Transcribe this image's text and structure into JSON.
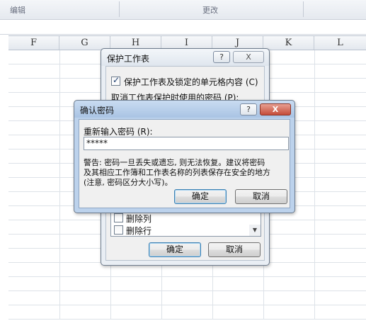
{
  "ribbon": {
    "group1": "编辑",
    "group2": "更改"
  },
  "columns": [
    "F",
    "G",
    "H",
    "I",
    "J",
    "K",
    "L"
  ],
  "protect_dialog": {
    "title": "保护工作表",
    "help_glyph": "?",
    "close_glyph": "X",
    "protect_checkbox_label": "保护工作表及锁定的单元格内容 (C)",
    "password_label": "取消工作表保护时使用的密码 (P):",
    "list_items": [
      "删除列",
      "删除行"
    ],
    "ok_label": "确定",
    "cancel_label": "取消"
  },
  "confirm_dialog": {
    "title": "确认密码",
    "help_glyph": "?",
    "close_glyph": "X",
    "reenter_label": "重新输入密码 (R):",
    "password_value": "*****",
    "warning_line1": "警告: 密码一旦丢失或遗忘, 则无法恢复。建议将密码",
    "warning_line2": "及其相应工作簿和工作表名称的列表保存在安全的地方",
    "warning_line3": "(注意, 密码区分大小写)。",
    "ok_label": "确定",
    "cancel_label": "取消"
  }
}
